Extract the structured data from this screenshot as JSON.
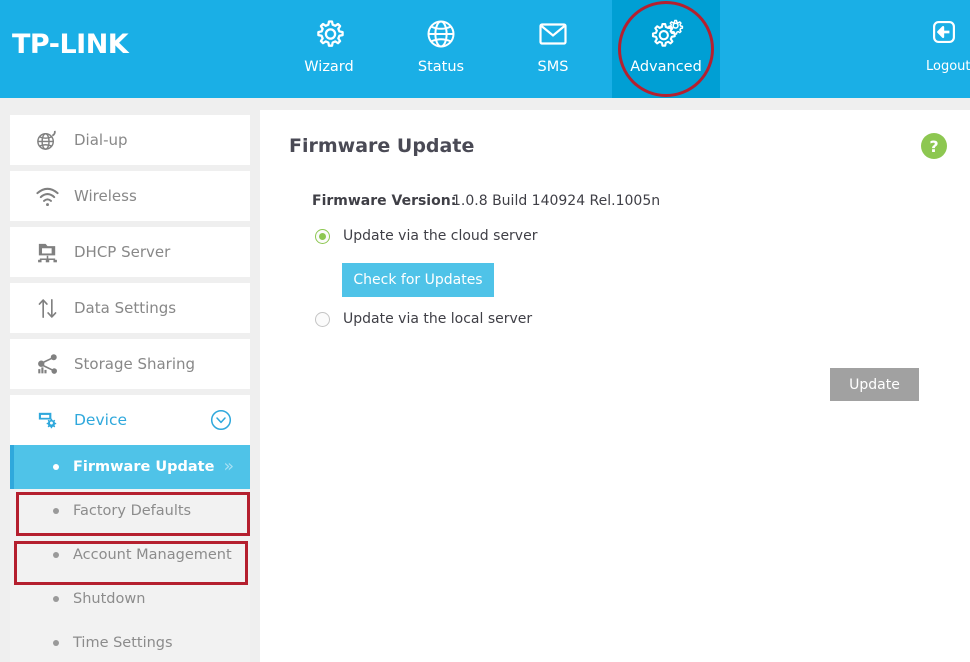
{
  "header": {
    "logo": "TP-LINK",
    "nav": [
      {
        "id": "wizard",
        "label": "Wizard",
        "icon": "gear-icon",
        "active": false
      },
      {
        "id": "status",
        "label": "Status",
        "icon": "globe-icon",
        "active": false
      },
      {
        "id": "sms",
        "label": "SMS",
        "icon": "envelope-icon",
        "active": false
      },
      {
        "id": "advanced",
        "label": "Advanced",
        "icon": "double-gear-icon",
        "active": true
      }
    ],
    "logout": {
      "label": "Logout",
      "icon": "logout-arrow-icon"
    },
    "colors": {
      "bar": "#1aafe6",
      "active_tab": "#009fd4",
      "annotation": "#b5202f"
    }
  },
  "sidebar": {
    "items": [
      {
        "id": "dial-up",
        "label": "Dial-up",
        "icon": "globe-signal-icon"
      },
      {
        "id": "wireless",
        "label": "Wireless",
        "icon": "wifi-icon"
      },
      {
        "id": "dhcp-server",
        "label": "DHCP Server",
        "icon": "network-monitor-icon"
      },
      {
        "id": "data-settings",
        "label": "Data Settings",
        "icon": "up-down-arrows-icon"
      },
      {
        "id": "storage-sharing",
        "label": "Storage Sharing",
        "icon": "share-nodes-icon"
      }
    ],
    "device": {
      "label": "Device",
      "icon": "device-gear-icon",
      "expanded": true,
      "chevron": "chevron-down-icon"
    },
    "submenu": [
      {
        "id": "firmware-update",
        "label": "Firmware Update",
        "active": true,
        "chevron": "»"
      },
      {
        "id": "factory-defaults",
        "label": "Factory Defaults",
        "active": false,
        "chevron": ""
      },
      {
        "id": "account-management",
        "label": "Account Management",
        "active": false,
        "chevron": ""
      },
      {
        "id": "shutdown",
        "label": "Shutdown",
        "active": false,
        "chevron": ""
      },
      {
        "id": "time-settings",
        "label": "Time Settings",
        "active": false,
        "chevron": ""
      }
    ]
  },
  "content": {
    "title": "Firmware Update",
    "help_icon_label": "?",
    "firmware_version_label": "Firmware Version:",
    "firmware_version_value": "1.0.8 Build 140924 Rel.1005n",
    "options": [
      {
        "id": "cloud",
        "label": "Update via the cloud server",
        "selected": true
      },
      {
        "id": "local",
        "label": "Update via the local server",
        "selected": false
      }
    ],
    "check_button": "Check for Updates",
    "update_button": "Update"
  }
}
